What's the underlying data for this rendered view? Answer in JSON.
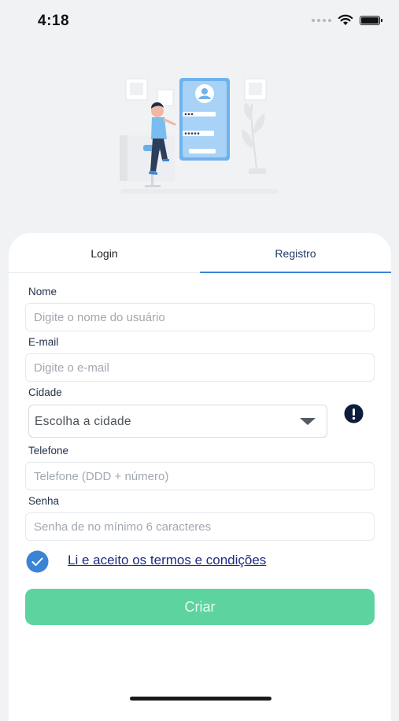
{
  "status_bar": {
    "time": "4:18"
  },
  "tabs": [
    {
      "label": "Login",
      "active": false
    },
    {
      "label": "Registro",
      "active": true
    }
  ],
  "form": {
    "name": {
      "label": "Nome",
      "placeholder": "Digite o nome do usuário",
      "value": ""
    },
    "email": {
      "label": "E-mail",
      "placeholder": "Digite o e-mail",
      "value": ""
    },
    "city": {
      "label": "Cidade",
      "selected": "Escolha a cidade"
    },
    "phone": {
      "label": "Telefone",
      "placeholder": "Telefone (DDD + número)",
      "value": ""
    },
    "password": {
      "label": "Senha",
      "placeholder": "Senha de no mínimo 6 caracteres",
      "value": ""
    },
    "terms": {
      "label": "Li e aceito os termos e condições",
      "checked": true
    },
    "submit_label": "Criar"
  },
  "colors": {
    "accent": "#3a84d6",
    "primary_button": "#5dd3a0",
    "link": "#1c2a82",
    "checkbox": "#3a84d6",
    "alert_icon": "#0c1c3c"
  }
}
